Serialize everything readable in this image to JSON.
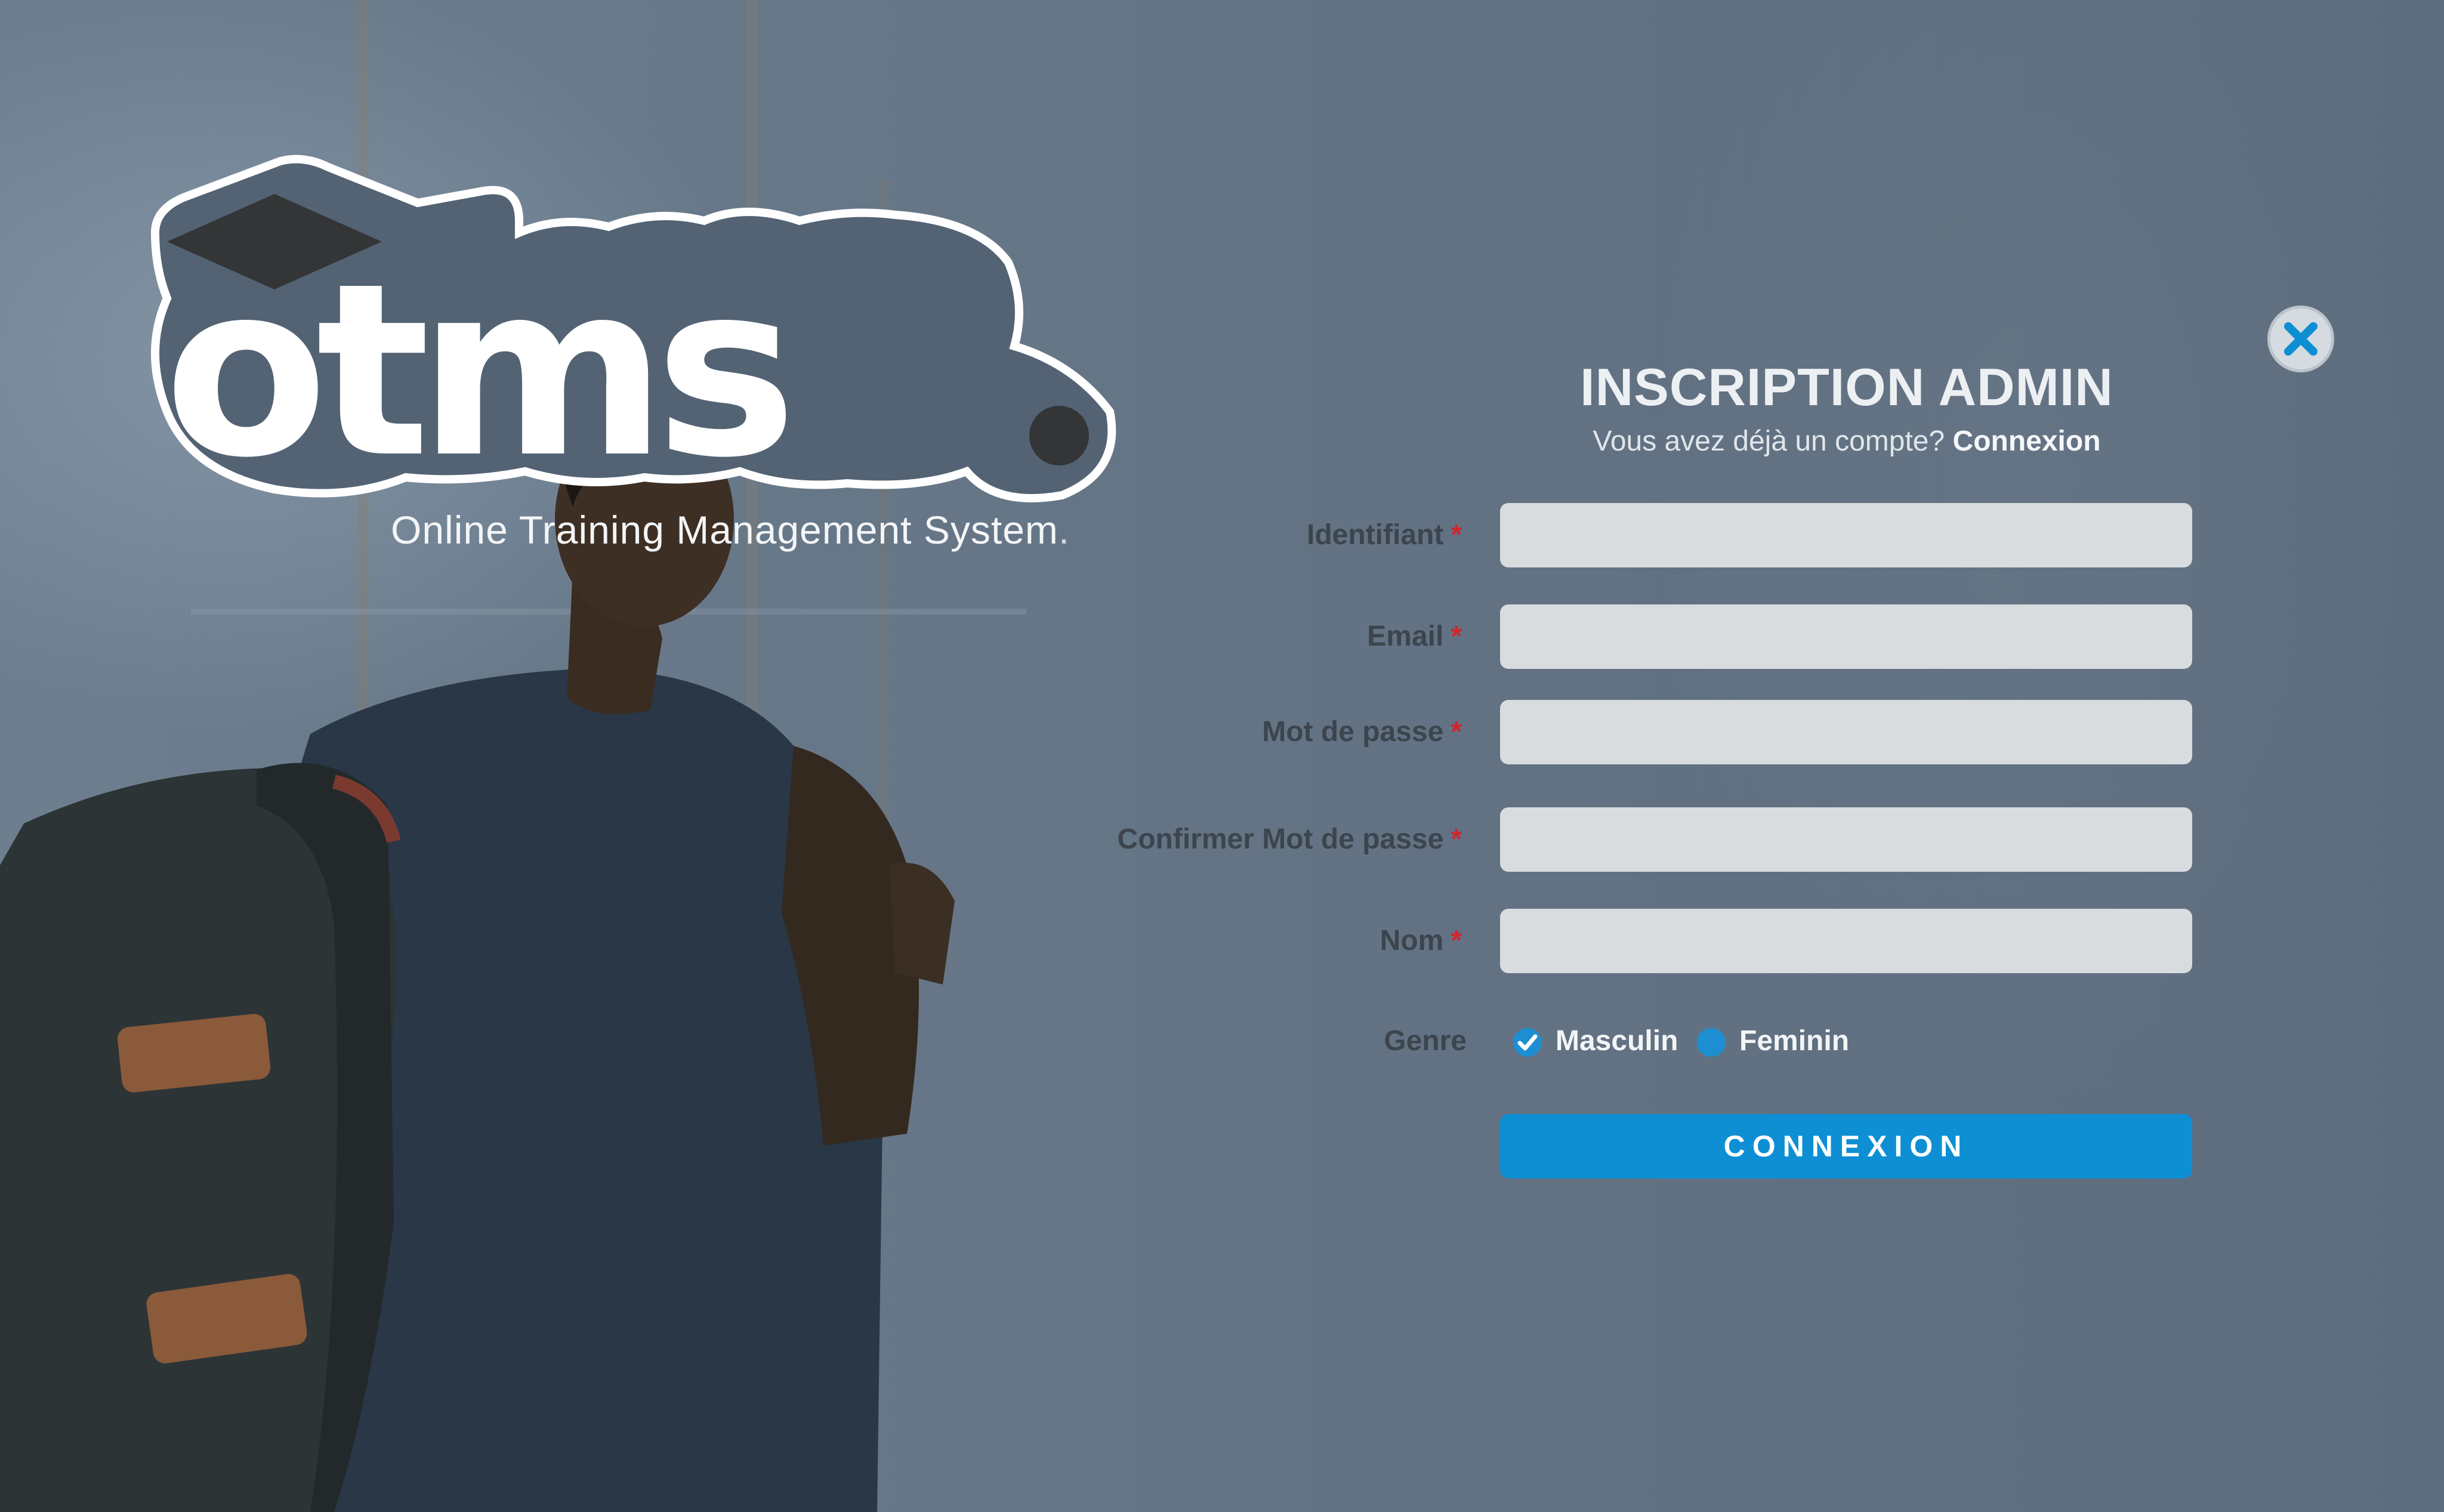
{
  "brand": {
    "logo_text": "otms",
    "tagline": "Online Training Management System",
    "tagline_dot": "."
  },
  "form": {
    "title": "INSCRIPTION ADMIN",
    "subtitle_text": "Vous avez déjà un compte?",
    "subtitle_link": "Connexion",
    "required_mark": "*",
    "fields": [
      {
        "label": "Identifiant",
        "value": ""
      },
      {
        "label": "Email",
        "value": ""
      },
      {
        "label": "Mot de passe",
        "value": ""
      },
      {
        "label": "Confirmer Mot de passe",
        "value": ""
      },
      {
        "label": "Nom",
        "value": ""
      }
    ],
    "genre": {
      "label": "Genre",
      "options": [
        "Masculin",
        "Feminin"
      ],
      "selected": "Masculin"
    },
    "submit_label": "CONNEXION"
  },
  "icons": {
    "close": "close-icon",
    "check": "checkmark-icon"
  },
  "colors": {
    "accent": "#0E8FD4",
    "required": "#D0262D",
    "input_bg": "#D8DCDF",
    "background": "#637384"
  }
}
